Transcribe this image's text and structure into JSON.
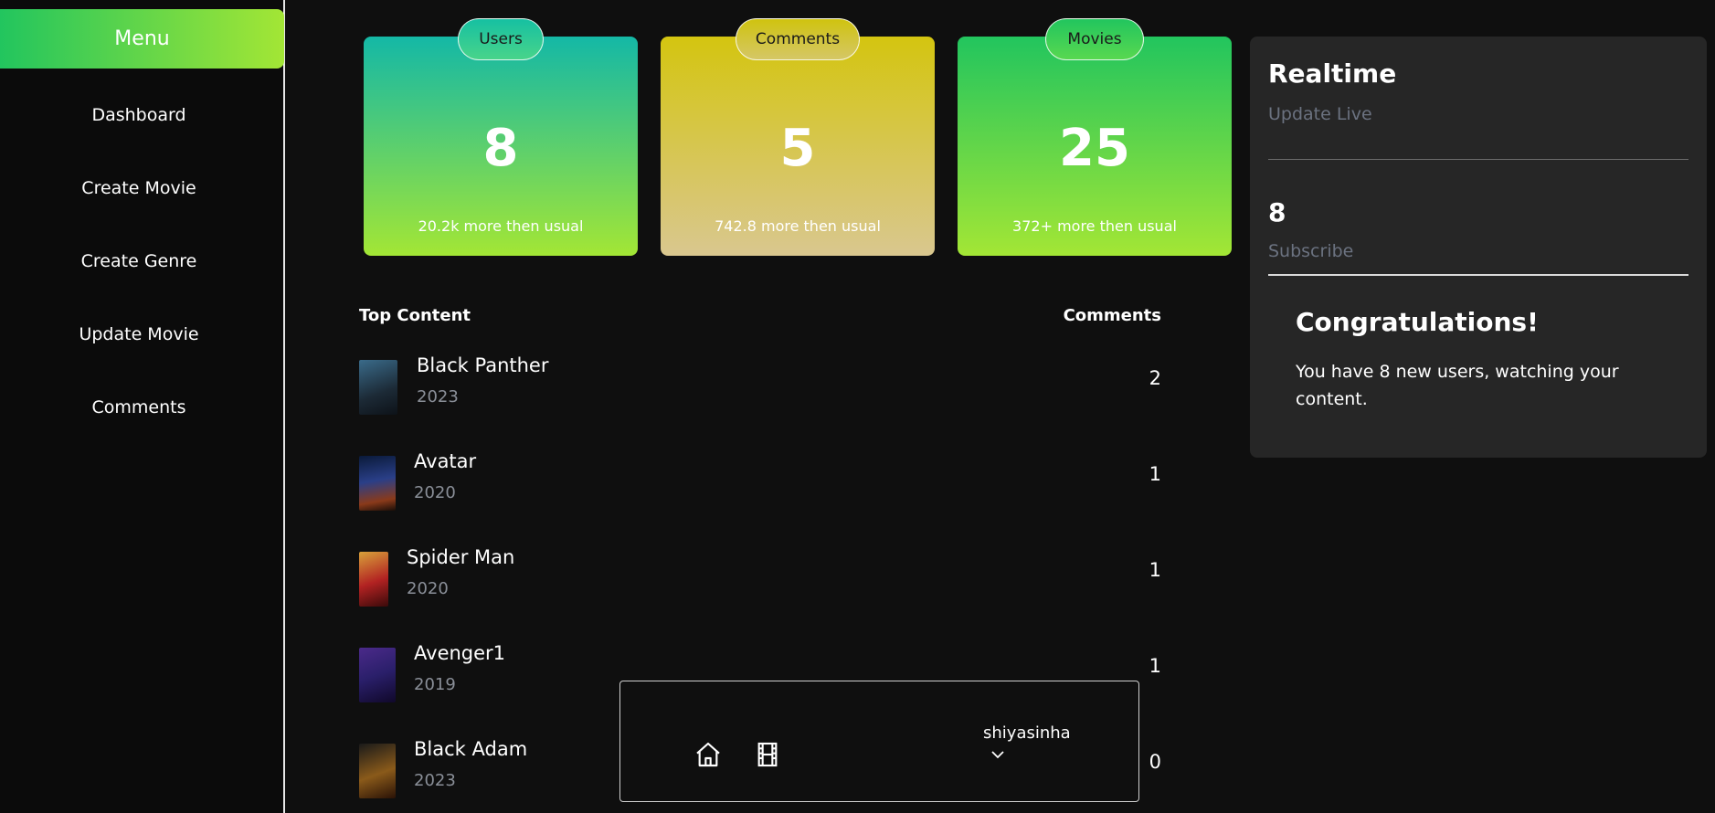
{
  "sidebar": {
    "menu_label": "Menu",
    "items": [
      {
        "label": "Dashboard"
      },
      {
        "label": "Create Movie"
      },
      {
        "label": "Create Genre"
      },
      {
        "label": "Update Movie"
      },
      {
        "label": "Comments"
      }
    ]
  },
  "stats": [
    {
      "label": "Users",
      "value": "8",
      "sub": "20.2k more then usual"
    },
    {
      "label": "Comments",
      "value": "5",
      "sub": "742.8 more then usual"
    },
    {
      "label": "Movies",
      "value": "25",
      "sub": "372+ more then usual"
    }
  ],
  "top_content": {
    "header_left": "Top Content",
    "header_right": "Comments",
    "rows": [
      {
        "title": "Black Panther",
        "year": "2023",
        "comments": "2"
      },
      {
        "title": "Avatar",
        "year": "2020",
        "comments": "1"
      },
      {
        "title": "Spider Man",
        "year": "2020",
        "comments": "1"
      },
      {
        "title": "Avenger1",
        "year": "2019",
        "comments": "1"
      },
      {
        "title": "Black Adam",
        "year": "2023",
        "comments": "0"
      }
    ]
  },
  "realtime": {
    "title": "Realtime",
    "subtitle": "Update Live",
    "subscribe_count": "8",
    "subscribe_label": "Subscribe",
    "congrats_title": "Congratulations!",
    "congrats_text": "You have 8 new users, watching your content."
  },
  "bottom_bar": {
    "username": "shiyasinha",
    "icons": [
      "home-icon",
      "film-icon",
      "chevron-down-icon"
    ]
  },
  "colors": {
    "background": "#0f0f0f",
    "panel": "#262626",
    "accent_green": "#22c55e",
    "accent_lime": "#a3e635",
    "accent_teal": "#14b8a6",
    "accent_yellow": "#d4c510"
  }
}
